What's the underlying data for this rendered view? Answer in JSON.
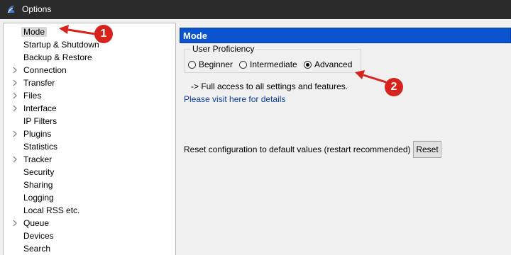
{
  "window": {
    "title": "Options"
  },
  "tree": {
    "items": [
      {
        "label": "Mode",
        "expandable": false,
        "selected": true
      },
      {
        "label": "Startup & Shutdown",
        "expandable": false
      },
      {
        "label": "Backup & Restore",
        "expandable": false
      },
      {
        "label": "Connection",
        "expandable": true
      },
      {
        "label": "Transfer",
        "expandable": true
      },
      {
        "label": "Files",
        "expandable": true
      },
      {
        "label": "Interface",
        "expandable": true
      },
      {
        "label": "IP Filters",
        "expandable": false
      },
      {
        "label": "Plugins",
        "expandable": true
      },
      {
        "label": "Statistics",
        "expandable": false
      },
      {
        "label": "Tracker",
        "expandable": true
      },
      {
        "label": "Security",
        "expandable": false
      },
      {
        "label": "Sharing",
        "expandable": false
      },
      {
        "label": "Logging",
        "expandable": false
      },
      {
        "label": "Local RSS etc.",
        "expandable": false
      },
      {
        "label": "Queue",
        "expandable": true
      },
      {
        "label": "Devices",
        "expandable": false
      },
      {
        "label": "Search",
        "expandable": false
      }
    ]
  },
  "panel": {
    "header": "Mode",
    "proficiency": {
      "title": "User Proficiency",
      "options": [
        "Beginner",
        "Intermediate",
        "Advanced"
      ],
      "selected": "Advanced"
    },
    "description": "-> Full access to all settings and features.",
    "details_link": "Please visit here for details",
    "reset_label": "Reset configuration to default values (restart recommended)",
    "reset_button": "Reset"
  },
  "annotations": {
    "badge_1": "1",
    "badge_2": "2",
    "color": "#d8231c"
  }
}
